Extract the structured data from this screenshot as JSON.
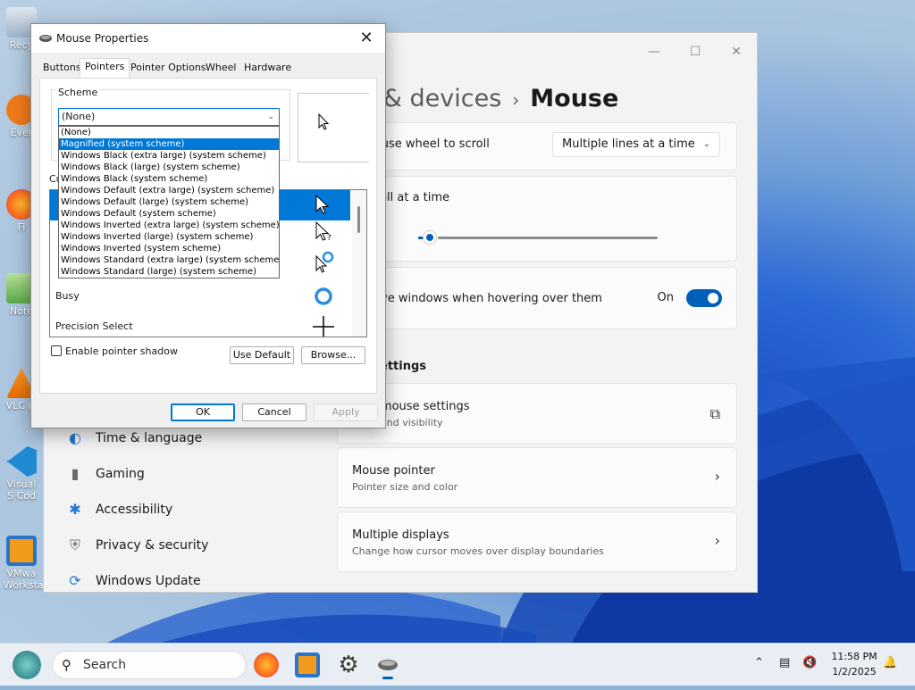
{
  "desktop": {
    "icons": [
      {
        "label": "Recy"
      },
      {
        "label": "Ever"
      },
      {
        "label": "Fi"
      },
      {
        "label": "Note"
      },
      {
        "label": "VLC pl"
      },
      {
        "label": "Visual S Cod"
      },
      {
        "label": "VMwa Workstati"
      }
    ]
  },
  "settings": {
    "heading": {
      "crumb": "tooth & devices",
      "separator": "›",
      "current": "Mouse"
    },
    "cards": {
      "scroll_mode_label": "e mouse wheel to scroll",
      "scroll_mode_value": "Multiple lines at a time",
      "lines_label": "o scroll at a time",
      "lines_value_fraction": 0.05,
      "inactive_label": "nactive windows when hovering over them",
      "inactive_state": "On"
    },
    "section_heading": "ettings",
    "related": [
      {
        "title": "onal mouse settings",
        "subtitle": "icons and visibility"
      },
      {
        "title": "Mouse pointer",
        "subtitle": "Pointer size and color"
      },
      {
        "title": "Multiple displays",
        "subtitle": "Change how cursor moves over display boundaries"
      }
    ],
    "nav": [
      {
        "label": "Time & language",
        "icon": "globe-clock-icon"
      },
      {
        "label": "Gaming",
        "icon": "gamepad-icon"
      },
      {
        "label": "Accessibility",
        "icon": "accessibility-icon"
      },
      {
        "label": "Privacy & security",
        "icon": "shield-icon"
      },
      {
        "label": "Windows Update",
        "icon": "update-icon"
      }
    ]
  },
  "dialog": {
    "title": "Mouse Properties",
    "tabs": [
      "Buttons",
      "Pointers",
      "Pointer Options",
      "Wheel",
      "Hardware"
    ],
    "active_tab": "Pointers",
    "scheme_label": "Scheme",
    "scheme_value": "(None)",
    "scheme_options": [
      "(None)",
      "Magnified (system scheme)",
      "Windows Black (extra large) (system scheme)",
      "Windows Black (large) (system scheme)",
      "Windows Black (system scheme)",
      "Windows Default (extra large) (system scheme)",
      "Windows Default (large) (system scheme)",
      "Windows Default (system scheme)",
      "Windows Inverted (extra large) (system scheme)",
      "Windows Inverted (large) (system scheme)",
      "Windows Inverted (system scheme)",
      "Windows Standard (extra large) (system scheme)",
      "Windows Standard (large) (system scheme)"
    ],
    "highlighted_option_index": 1,
    "customize_label": "Cu",
    "cursor_rows": [
      {
        "name": "",
        "icon": "arrow-cursor-icon"
      },
      {
        "name": "",
        "icon": "help-cursor-icon"
      },
      {
        "name": "",
        "icon": "working-cursor-icon"
      },
      {
        "name": "Busy",
        "icon": "busy-cursor-icon"
      },
      {
        "name": "Precision Select",
        "icon": "crosshair-cursor-icon"
      }
    ],
    "shadow_label": "Enable pointer shadow",
    "use_default": "Use Default",
    "browse": "Browse...",
    "ok": "OK",
    "cancel": "Cancel",
    "apply": "Apply"
  },
  "taskbar": {
    "search_placeholder": "Search",
    "time": "11:58 PM",
    "date": "1/2/2025"
  },
  "colors": {
    "accent": "#0078d7",
    "settings_accent": "#005fb8"
  }
}
